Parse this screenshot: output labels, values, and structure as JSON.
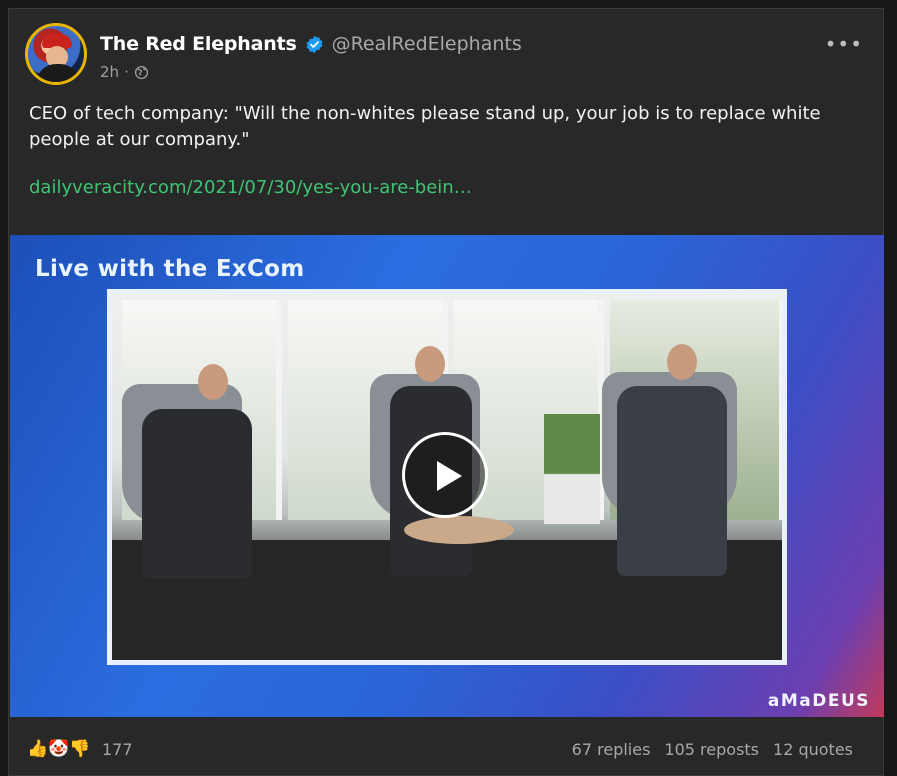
{
  "post": {
    "author": {
      "display_name": "The Red Elephants",
      "handle": "@RealRedElephants",
      "verified": true,
      "verified_color": "#1d9bf0"
    },
    "time": "2h",
    "separator": "·",
    "visibility_icon": "globe-icon",
    "more_label": "•••",
    "text": "CEO of tech company: \"Will the non-whites please stand up, your job is to replace white people at our company.\"",
    "link_text": "dailyveracity.com/2021/07/30/yes-you-are-bein…",
    "link_color": "#3fc474",
    "media": {
      "video_title": "Live with the ExCom",
      "brand": "aMaDEUS"
    },
    "reactions": {
      "icons": [
        "thumbs-up-icon",
        "clown-face-icon",
        "thumbs-down-icon"
      ],
      "glyphs": [
        "👍",
        "🤡",
        "👎"
      ],
      "count": "177"
    },
    "stats": {
      "replies": "67 replies",
      "reposts": "105 reposts",
      "quotes": "12 quotes"
    }
  }
}
